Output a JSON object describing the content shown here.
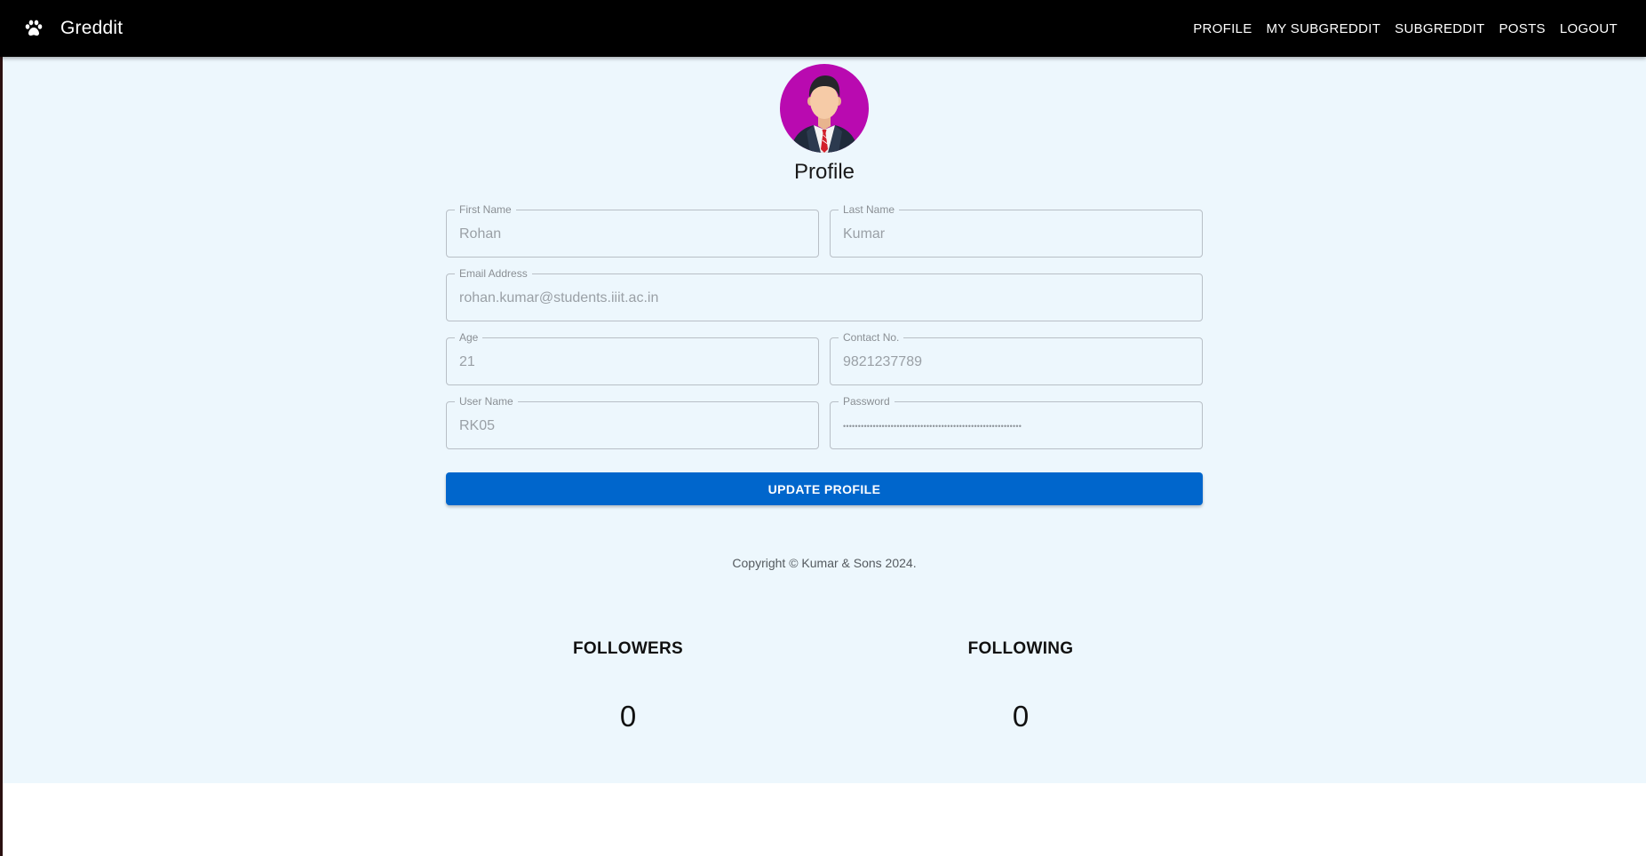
{
  "app": {
    "title": "Greddit",
    "brand_icon": "paw-icon"
  },
  "nav": {
    "items": [
      "PROFILE",
      "MY SUBGREDDIT",
      "SUBGREDDIT",
      "POSTS",
      "LOGOUT"
    ]
  },
  "profile": {
    "title": "Profile",
    "avatar_icon": "businessman-avatar"
  },
  "form": {
    "first_name": {
      "label": "First Name",
      "value": "Rohan"
    },
    "last_name": {
      "label": "Last Name",
      "value": "Kumar"
    },
    "email": {
      "label": "Email Address",
      "value": "rohan.kumar@students.iiit.ac.in"
    },
    "age": {
      "label": "Age",
      "value": "21"
    },
    "contact": {
      "label": "Contact No.",
      "value": "9821237789"
    },
    "username": {
      "label": "User Name",
      "value": "RK05"
    },
    "password": {
      "label": "Password",
      "value": "••••••••••••••••••••••••••••••••••••••••••••••••••••••••••••"
    },
    "submit_label": "UPDATE PROFILE"
  },
  "footer": {
    "copyright": "Copyright © Kumar & Sons 2024."
  },
  "stats": {
    "followers": {
      "label": "FOLLOWERS",
      "count": "0"
    },
    "following": {
      "label": "FOLLOWING",
      "count": "0"
    }
  },
  "colors": {
    "appbar": "#000000",
    "page_background": "#edf7fd",
    "primary_button": "#0066cc",
    "avatar_background": "#b90ab0"
  }
}
